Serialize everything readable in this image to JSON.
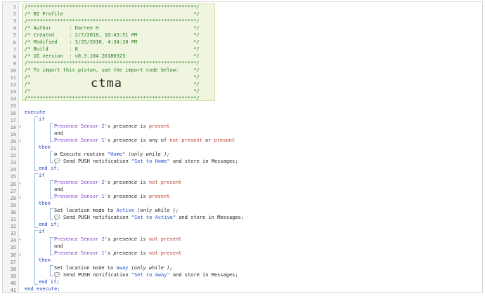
{
  "editor": {
    "line_numbers": [
      "1",
      "2",
      "3",
      "4",
      "5",
      "6",
      "7",
      "8",
      "9",
      "10",
      "11",
      "12",
      "13",
      "14",
      "15",
      "16",
      "17",
      "18",
      "19",
      "20",
      "21",
      "22",
      "23",
      "24",
      "25",
      "26",
      "27",
      "28",
      "29",
      "30",
      "31",
      "32",
      "33",
      "34",
      "35",
      "36",
      "37",
      "38",
      "39",
      "40",
      "41"
    ],
    "bolt_lines": [
      18,
      20,
      26,
      28,
      34,
      36
    ]
  },
  "header": {
    "stars": "/*********************************************************/",
    "title_line": "/* BI Profile                                            */",
    "author": "/* Author      : Darren H                                */",
    "created": "/* Created     : 2/7/2018, 10:43:51 PM                   */",
    "modified": "/* Modified    : 3/25/2018, 4:34:28 PM                   */",
    "build": "/* Build       : 8                                       */",
    "ui_version": "/* UI version  : v0.3.104.20180323                       */",
    "import_note": "/* To import this piston, use the import code below:     */",
    "blank": "/*                                                       */",
    "import_code": "ctma"
  },
  "code": {
    "execute": "execute",
    "end_execute": "end execute;",
    "if": "if",
    "and": "and",
    "then": "then",
    "end_if": "end if;",
    "sensor2": "Presence Sensor 2",
    "sensor1": "Presence Sensor 1",
    "possessive": "'s ",
    "presence": "presence",
    "is": " is ",
    "is_any_of": " is any of ",
    "or": " or ",
    "present": "present",
    "not_present": "not present",
    "execute_routine": "Execute routine ",
    "routine_home": "\"Home\"",
    "only_while": "(only while );",
    "send_push": "Send PUSH notification ",
    "msg_home": "\"Set to Home\"",
    "msg_active": "\"Set to Active\"",
    "msg_away": "\"Set to Away\"",
    "store_suffix": " and store in Messages;",
    "set_location_mode": "Set location mode to ",
    "mode_active": "Active",
    "mode_away": "Away"
  }
}
